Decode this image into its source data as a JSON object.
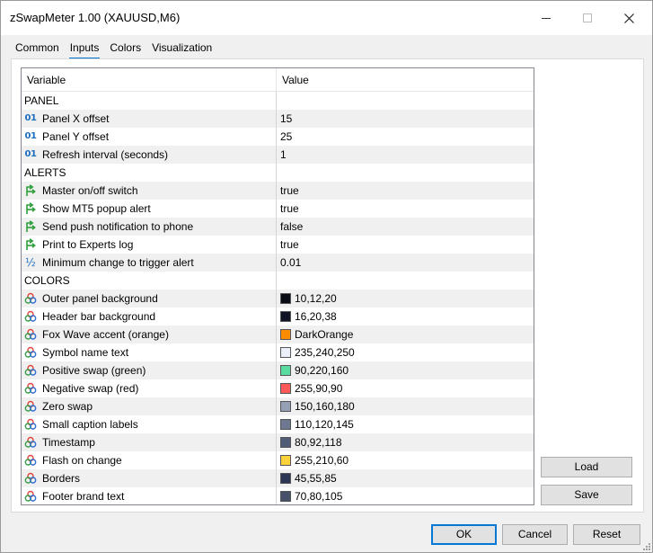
{
  "window": {
    "title": "zSwapMeter 1.00 (XAUUSD,M6)"
  },
  "tabs": [
    {
      "label": "Common",
      "active": false
    },
    {
      "label": "Inputs",
      "active": true
    },
    {
      "label": "Colors",
      "active": false
    },
    {
      "label": "Visualization",
      "active": false
    }
  ],
  "grid": {
    "header": {
      "variable": "Variable",
      "value": "Value"
    },
    "rows": [
      {
        "kind": "section",
        "label": "PANEL"
      },
      {
        "kind": "param",
        "icon": "integer-icon",
        "label": "Panel X offset",
        "value": "15"
      },
      {
        "kind": "param",
        "icon": "integer-icon",
        "label": "Panel Y offset",
        "value": "25"
      },
      {
        "kind": "param",
        "icon": "integer-icon",
        "label": "Refresh interval (seconds)",
        "value": "1"
      },
      {
        "kind": "section",
        "label": "ALERTS"
      },
      {
        "kind": "param",
        "icon": "bool-icon",
        "label": "Master on/off switch",
        "value": "true"
      },
      {
        "kind": "param",
        "icon": "bool-icon",
        "label": "Show MT5 popup alert",
        "value": "true"
      },
      {
        "kind": "param",
        "icon": "bool-icon",
        "label": "Send push notification to phone",
        "value": "false"
      },
      {
        "kind": "param",
        "icon": "bool-icon",
        "label": "Print to Experts log",
        "value": "true"
      },
      {
        "kind": "param",
        "icon": "double-icon",
        "label": "Minimum change to trigger alert",
        "value": "0.01"
      },
      {
        "kind": "section",
        "label": "COLORS"
      },
      {
        "kind": "color",
        "icon": "color-icon",
        "label": "Outer panel background",
        "value": "10,12,20",
        "swatch": "#0a0c14"
      },
      {
        "kind": "color",
        "icon": "color-icon",
        "label": "Header bar background",
        "value": "16,20,38",
        "swatch": "#101426"
      },
      {
        "kind": "color",
        "icon": "color-icon",
        "label": "Fox Wave accent (orange)",
        "value": "DarkOrange",
        "swatch": "#ff8c00"
      },
      {
        "kind": "color",
        "icon": "color-icon",
        "label": "Symbol name text",
        "value": "235,240,250",
        "swatch": "#ebf0fa"
      },
      {
        "kind": "color",
        "icon": "color-icon",
        "label": "Positive swap (green)",
        "value": "90,220,160",
        "swatch": "#5adca0"
      },
      {
        "kind": "color",
        "icon": "color-icon",
        "label": "Negative swap (red)",
        "value": "255,90,90",
        "swatch": "#ff5a5a"
      },
      {
        "kind": "color",
        "icon": "color-icon",
        "label": "Zero swap",
        "value": "150,160,180",
        "swatch": "#96a0b4"
      },
      {
        "kind": "color",
        "icon": "color-icon",
        "label": "Small caption labels",
        "value": "110,120,145",
        "swatch": "#6e7891"
      },
      {
        "kind": "color",
        "icon": "color-icon",
        "label": "Timestamp",
        "value": "80,92,118",
        "swatch": "#505c76"
      },
      {
        "kind": "color",
        "icon": "color-icon",
        "label": "Flash on change",
        "value": "255,210,60",
        "swatch": "#ffd23c"
      },
      {
        "kind": "color",
        "icon": "color-icon",
        "label": "Borders",
        "value": "45,55,85",
        "swatch": "#2d3755"
      },
      {
        "kind": "color",
        "icon": "color-icon",
        "label": "Footer brand text",
        "value": "70,80,105",
        "swatch": "#465069"
      }
    ]
  },
  "side_buttons": {
    "load": "Load",
    "save": "Save"
  },
  "footer_buttons": {
    "ok": "OK",
    "cancel": "Cancel",
    "reset": "Reset"
  },
  "colors": {
    "accent": "#0078d7",
    "int_icon": "#1e6fc0",
    "bool_icon": "#2e9e3a"
  }
}
